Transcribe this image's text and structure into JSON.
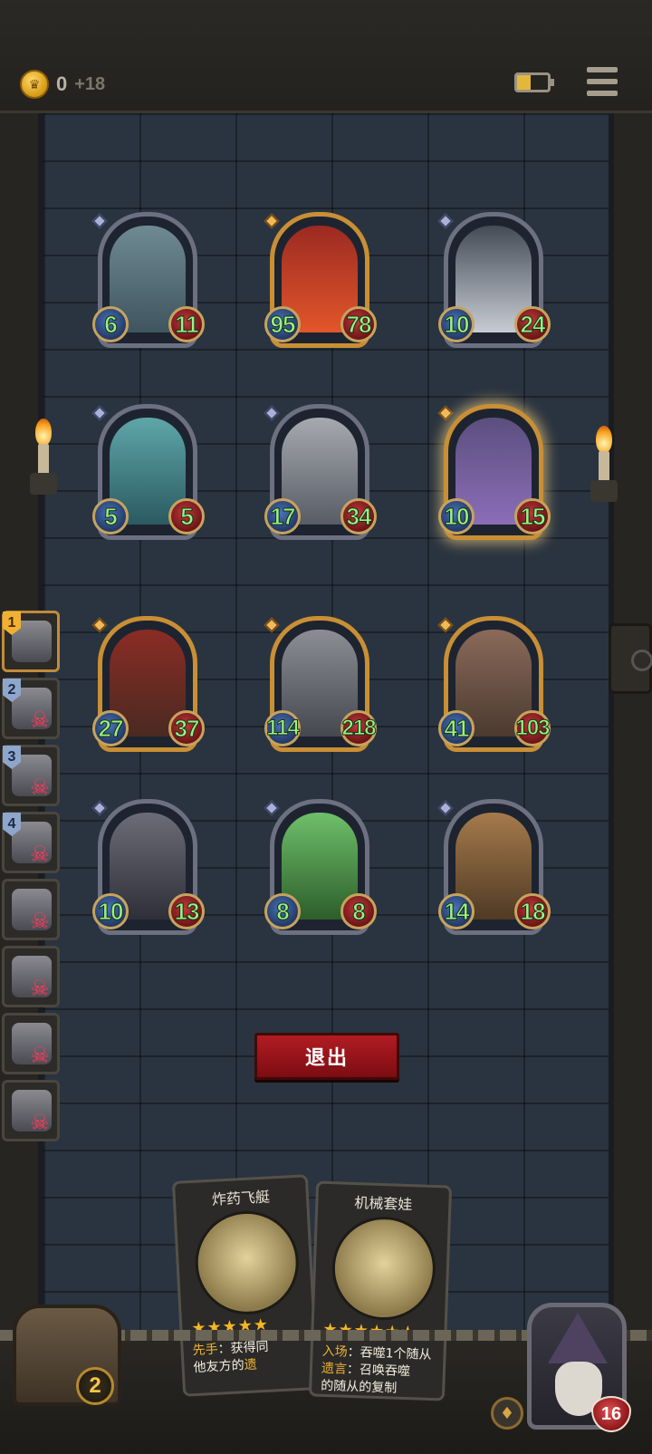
{
  "header": {
    "gold_value": "0",
    "gold_income": "+18",
    "coin_icon": "crown-coin-icon",
    "battery_level": 0.45,
    "menu_icon": "hamburger-menu-icon"
  },
  "board": {
    "enemy_rows": [
      [
        {
          "name": "shark-brute",
          "attack": "6",
          "health": "11",
          "border": "silver"
        },
        {
          "name": "red-dragon",
          "attack": "95",
          "health": "78",
          "border": "gold"
        },
        {
          "name": "skull-demon",
          "attack": "10",
          "health": "24",
          "border": "silver"
        }
      ],
      [
        {
          "name": "crystal-beast",
          "attack": "5",
          "health": "5",
          "border": "silver"
        },
        {
          "name": "robot-heart",
          "attack": "17",
          "health": "34",
          "border": "silver"
        },
        {
          "name": "helmet-brute",
          "attack": "10",
          "health": "15",
          "border": "gold",
          "highlight": true
        }
      ]
    ],
    "player_rows": [
      [
        {
          "name": "red-hood-assassin",
          "attack": "27",
          "health": "37",
          "border": "gold"
        },
        {
          "name": "armored-knight",
          "attack": "114",
          "health": "218",
          "border": "gold"
        },
        {
          "name": "bald-brute",
          "attack": "41",
          "health": "103",
          "border": "gold"
        }
      ],
      [
        {
          "name": "rose-wizard",
          "attack": "10",
          "health": "13",
          "border": "silver"
        },
        {
          "name": "ghost-bat",
          "attack": "8",
          "health": "8",
          "border": "silver"
        },
        {
          "name": "cowboy-adventurer",
          "attack": "14",
          "health": "18",
          "border": "silver"
        }
      ]
    ]
  },
  "opponents": [
    {
      "rank": "1",
      "eliminated": false
    },
    {
      "rank": "2",
      "eliminated": true
    },
    {
      "rank": "3",
      "eliminated": true
    },
    {
      "rank": "4",
      "eliminated": true
    },
    {
      "rank": "",
      "eliminated": true
    },
    {
      "rank": "",
      "eliminated": true
    },
    {
      "rank": "",
      "eliminated": true
    },
    {
      "rank": "",
      "eliminated": true
    }
  ],
  "exit_button": "退出",
  "hand": [
    {
      "title": "炸药飞艇",
      "stars": "★★★★★",
      "line1_keyword": "先手",
      "line1_text": "：获得同",
      "line2_text": "他友方的",
      "line2_keyword": "遗"
    },
    {
      "title": "机械套娃",
      "stars": "★★★★★★",
      "line1_keyword": "入场",
      "line1_text": "：吞噬1个随从",
      "line2_keyword": "遗言",
      "line2_text": "：召唤吞噬",
      "line3_text": "的随从的复制"
    }
  ],
  "chest_count": "2",
  "hero": {
    "health": "16"
  },
  "colors": {
    "accent_gold": "#c98f35",
    "exit_red": "#b11c22",
    "stat_green": "#9cf08a"
  }
}
